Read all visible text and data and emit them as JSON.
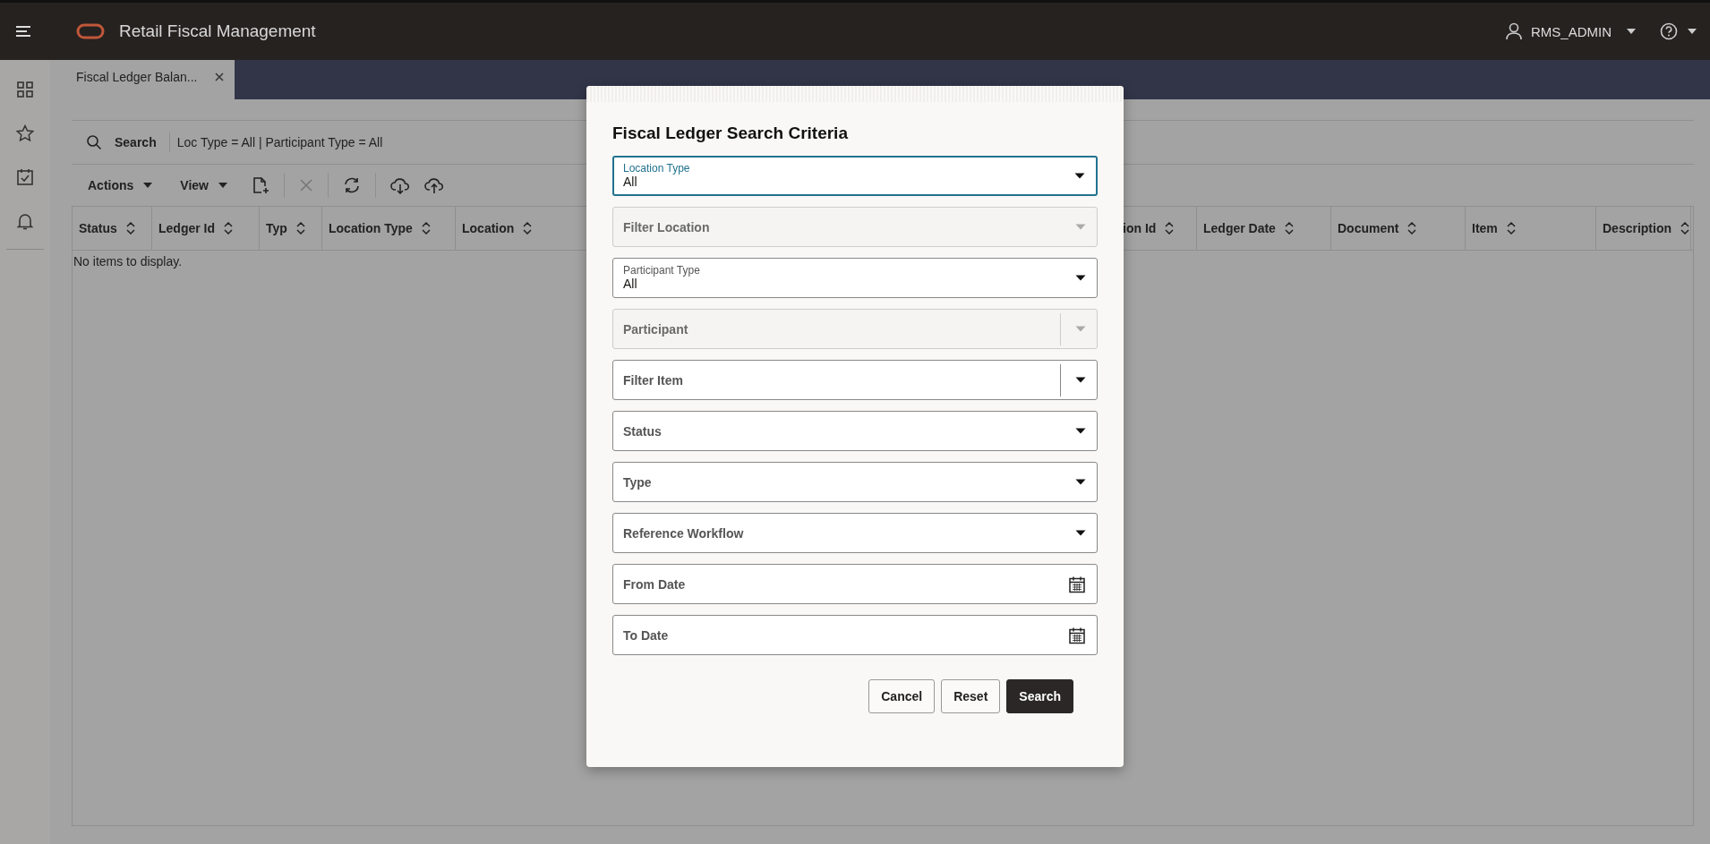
{
  "app": {
    "title": "Retail Fiscal Management",
    "user": "RMS_ADMIN"
  },
  "tabs": [
    {
      "label": "Fiscal Ledger Balan...",
      "selected": true
    }
  ],
  "search_bar": {
    "label": "Search",
    "criteria": "Loc Type = All | Participant Type = All"
  },
  "toolbar": {
    "menus": [
      "Actions",
      "View"
    ],
    "icon_buttons": [
      {
        "kind": "add-document",
        "disabled": false
      },
      {
        "kind": "delete",
        "disabled": true
      },
      {
        "kind": "refresh",
        "disabled": false
      },
      {
        "kind": "download",
        "disabled": false
      },
      {
        "kind": "upload",
        "disabled": false
      }
    ]
  },
  "table": {
    "columns": [
      "Status",
      "Ledger Id",
      "Typ",
      "Location Type",
      "Location",
      "ion Id",
      "Ledger Date",
      "Document",
      "Item",
      "Description"
    ],
    "empty_text": "No items to display."
  },
  "dialog": {
    "title": "Fiscal Ledger Search Criteria",
    "fields": [
      {
        "kind": "select",
        "label": "Location Type",
        "value": "All",
        "focused": true,
        "disabled": false
      },
      {
        "kind": "select",
        "placeholder": "Filter Location",
        "focused": false,
        "disabled": true
      },
      {
        "kind": "select",
        "label": "Participant Type",
        "value": "All",
        "focused": false,
        "disabled": false
      },
      {
        "kind": "combobox",
        "placeholder": "Participant",
        "focused": false,
        "disabled": true
      },
      {
        "kind": "combobox",
        "placeholder": "Filter Item",
        "focused": false,
        "disabled": false
      },
      {
        "kind": "select",
        "placeholder": "Status",
        "focused": false,
        "disabled": false
      },
      {
        "kind": "select",
        "placeholder": "Type",
        "focused": false,
        "disabled": false
      },
      {
        "kind": "select",
        "placeholder": "Reference Workflow",
        "focused": false,
        "disabled": false
      },
      {
        "kind": "date",
        "placeholder": "From Date",
        "focused": false,
        "disabled": false
      },
      {
        "kind": "date",
        "placeholder": "To Date",
        "focused": false,
        "disabled": false
      }
    ],
    "buttons": [
      {
        "label": "Cancel",
        "kind": "secondary"
      },
      {
        "label": "Reset",
        "kind": "secondary"
      },
      {
        "label": "Search",
        "kind": "primary"
      }
    ]
  }
}
